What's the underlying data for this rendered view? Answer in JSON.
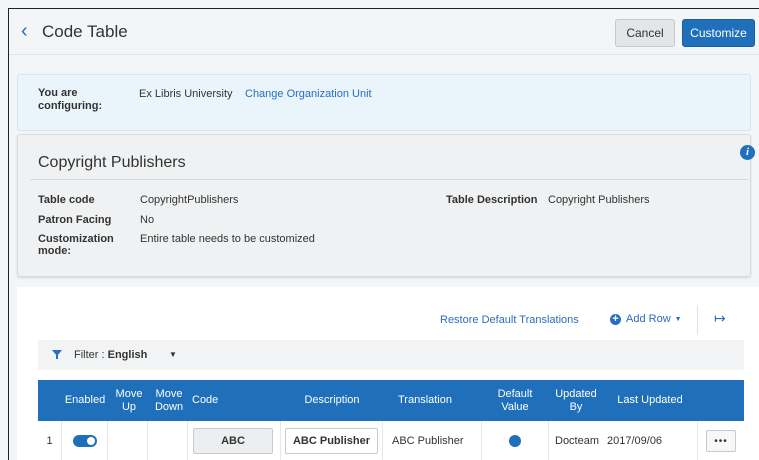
{
  "header": {
    "title": "Code Table",
    "cancel_label": "Cancel",
    "customize_label": "Customize"
  },
  "config": {
    "label": "You are configuring:",
    "org": "Ex Libris University",
    "change_link": "Change Organization Unit"
  },
  "details": {
    "title": "Copyright Publishers",
    "table_code_label": "Table code",
    "table_code": "CopyrightPublishers",
    "table_description_label": "Table Description",
    "table_description": "Copyright Publishers",
    "patron_facing_label": "Patron Facing",
    "patron_facing": "No",
    "customization_label": "Customization mode:",
    "customization": "Entire table needs to be customized"
  },
  "toolbar": {
    "restore_label": "Restore Default Translations",
    "add_row_label": "Add Row"
  },
  "filter": {
    "prefix": "Filter : ",
    "value": "English"
  },
  "table": {
    "columns": [
      "Enabled",
      "Move Up",
      "Move Down",
      "Code",
      "Description",
      "Translation",
      "Default Value",
      "Updated By",
      "Last Updated"
    ],
    "rows": [
      {
        "index": "1",
        "enabled": true,
        "code": "ABC",
        "description": "ABC Publisher",
        "translation": "ABC Publisher",
        "default_value": true,
        "updated_by": "Docteam",
        "last_updated": "2017/09/06"
      }
    ]
  },
  "colors": {
    "accent": "#1f6fba",
    "link": "#2a6ebb",
    "config_bg": "#e9f4fb"
  }
}
